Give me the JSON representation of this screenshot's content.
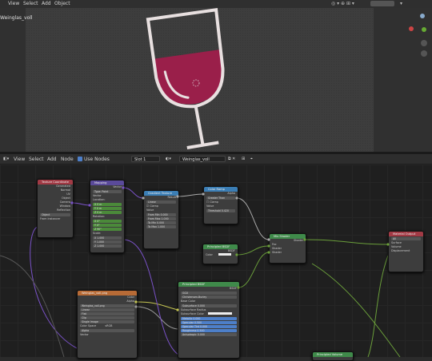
{
  "viewport": {
    "object_name": "Weinglas_voll",
    "menu": [
      "View",
      "Select",
      "Add",
      "Object"
    ]
  },
  "node_editor": {
    "menu": [
      "View",
      "Select",
      "Add",
      "Node"
    ],
    "use_nodes_label": "Use Nodes",
    "slot": "Slot 1",
    "material": "Weinglas_voll"
  },
  "nodes": {
    "texture_coordinate": "Texture Coordinate",
    "mapping": "Mapping",
    "mapping_vector": "Vector",
    "color_ramp": "Color Ramp",
    "gradient_texture": "Gradient Texture",
    "principled_bsdf_small": "Principled BSDF",
    "mix_shader": "Mix Shader",
    "material_output": "Material Output",
    "principled_bsdf": "Principled BSDF",
    "image_texture": "Weinglas_voll.png",
    "image_name": "Weinglas_voll.png",
    "principled_volume": "Principled Volume"
  },
  "colors": {
    "wine": "#9a1f4a",
    "glass_outline": "#e8e0e0",
    "wire_green": "#7a9e3a",
    "wire_gray": "#9a9a9a"
  }
}
